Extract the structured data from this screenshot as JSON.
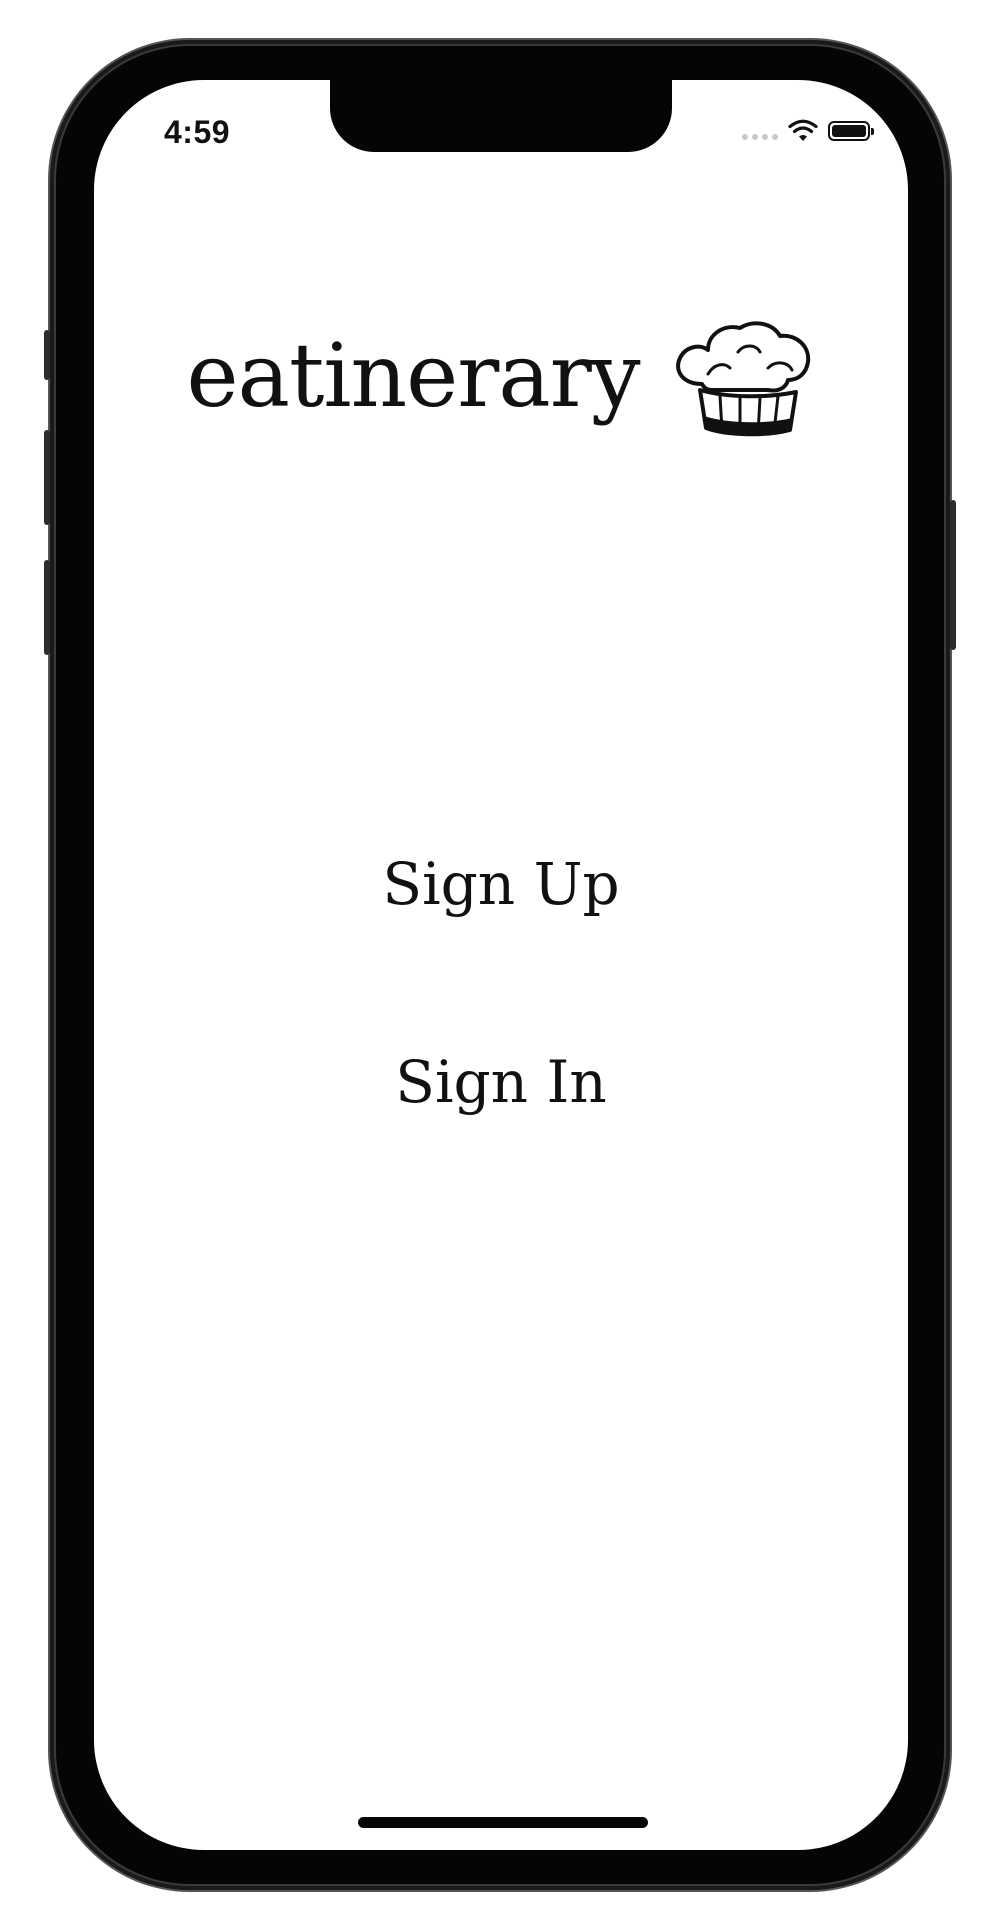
{
  "status_bar": {
    "time": "4:59",
    "icons": [
      "signal-icon",
      "wifi-icon",
      "battery-icon"
    ]
  },
  "app": {
    "title": "eatinerary",
    "logo_icon": "chef-hat-icon"
  },
  "actions": {
    "sign_up_label": "Sign Up",
    "sign_in_label": "Sign In"
  },
  "colors": {
    "background": "#ffffff",
    "text": "#111111",
    "frame": "#050505"
  }
}
